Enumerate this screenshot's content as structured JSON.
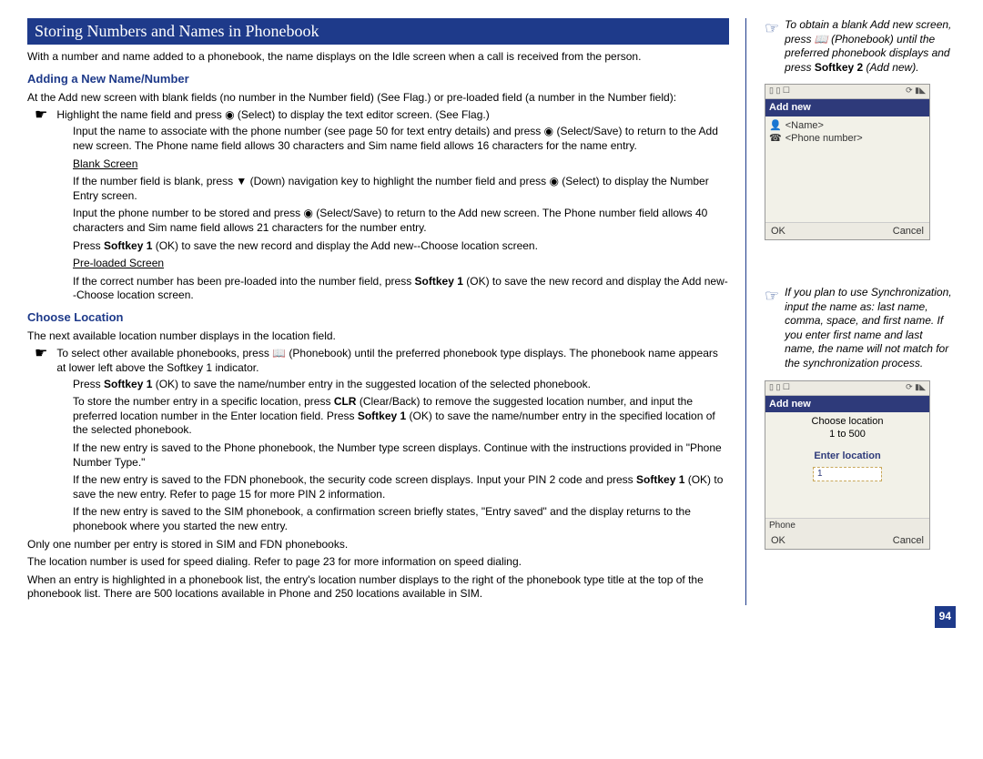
{
  "header": {
    "title": "Storing Numbers and Names in Phonebook"
  },
  "intro": "With a number and name added to a phonebook, the name displays on the Idle screen when a call is received from the person.",
  "section1": {
    "heading": "Adding a New Name/Number",
    "lead": "At the Add new screen with blank fields (no number in the Number field) (See Flag.) or pre-loaded field (a number in the Number field):",
    "b1": "Highlight the name field and press ◉ (Select) to display the text editor screen. (See Flag.)",
    "b1a": "Input the name to associate with the phone number (see page 50 for text entry details) and press ◉ (Select/Save) to return to the Add new screen. The Phone name field allows 30 characters and Sim name field allows 16 characters for the name entry.",
    "blank": "Blank Screen",
    "blank1": "If the number field is blank, press ▼ (Down) navigation key to highlight the number field and press ◉ (Select) to display the Number Entry screen.",
    "blank2": "Input the phone number to be stored and press ◉ (Select/Save) to return to the Add new screen. The Phone number field allows 40 characters and Sim name field allows 21 characters for the number entry.",
    "blank3_a": "Press ",
    "blank3_b": "Softkey 1",
    "blank3_c": " (OK) to save the new record and display the Add new--Choose location screen.",
    "preloaded": "Pre-loaded Screen",
    "preloaded1_a": "If the correct number has been pre-loaded into the number field, press ",
    "preloaded1_b": "Softkey 1",
    "preloaded1_c": " (OK) to save the new record and display the Add new--Choose location screen."
  },
  "section2": {
    "heading": "Choose Location",
    "p1": "The next available location number displays in the location field.",
    "b1": "To select other available phonebooks, press 📖 (Phonebook) until the preferred phonebook type displays. The phonebook name appears at lower left above the Softkey 1 indicator.",
    "b1a_a": "Press ",
    "b1a_b": "Softkey 1",
    "b1a_c": " (OK) to save the name/number entry in the suggested location of the selected phonebook.",
    "b1b_a": "To store the number entry in a specific location, press ",
    "b1b_b": "CLR",
    "b1b_c": " (Clear/Back) to remove the suggested location number, and input the preferred location number in the Enter location field. Press ",
    "b1b_d": "Softkey 1",
    "b1b_e": " (OK) to save the name/number entry in the specified location of the selected phonebook.",
    "b1c": "If the new entry is saved to the Phone phonebook, the Number type screen displays. Continue with the instructions provided in \"Phone Number Type.\"",
    "b1d_a": "If the new entry is saved to the FDN phonebook, the security code screen displays. Input your PIN 2 code and press ",
    "b1d_b": "Softkey 1",
    "b1d_c": " (OK) to save the new entry. Refer to page 15 for more PIN 2 information.",
    "b1e": "If the new entry is saved to the SIM phonebook, a confirmation screen briefly states, \"Entry saved\" and the display returns to the phonebook where you started the new entry.",
    "p2": "Only one number per entry is stored in SIM and FDN phonebooks.",
    "p3": "The location number is used for speed dialing. Refer to page 23 for more information on speed dialing.",
    "p4": "When an entry is highlighted in a phonebook list, the entry's location number displays to the right of the phonebook type title at the top of the phonebook list. There are 500 locations available in Phone and 250 locations available in SIM."
  },
  "sidebar": {
    "note1_a": "To obtain a blank Add new screen, press 📖 (Phonebook) until the preferred phonebook displays and press ",
    "note1_b": "Softkey 2",
    "note1_c": " (Add new).",
    "note2": "If you plan to use Synchronization, input the name as: last name, comma, space, and first name. If you enter first name and last name, the name will not match for the synchronization process."
  },
  "screens": {
    "s1": {
      "title": "Add new",
      "name": "<Name>",
      "phone": "<Phone number>",
      "ok": "OK",
      "cancel": "Cancel"
    },
    "s2": {
      "title": "Add new",
      "line1": "Choose location",
      "line2": "1 to 500",
      "enter": "Enter location",
      "val": "1",
      "phone_label": "Phone",
      "ok": "OK",
      "cancel": "Cancel"
    }
  },
  "page": {
    "num": "94"
  }
}
